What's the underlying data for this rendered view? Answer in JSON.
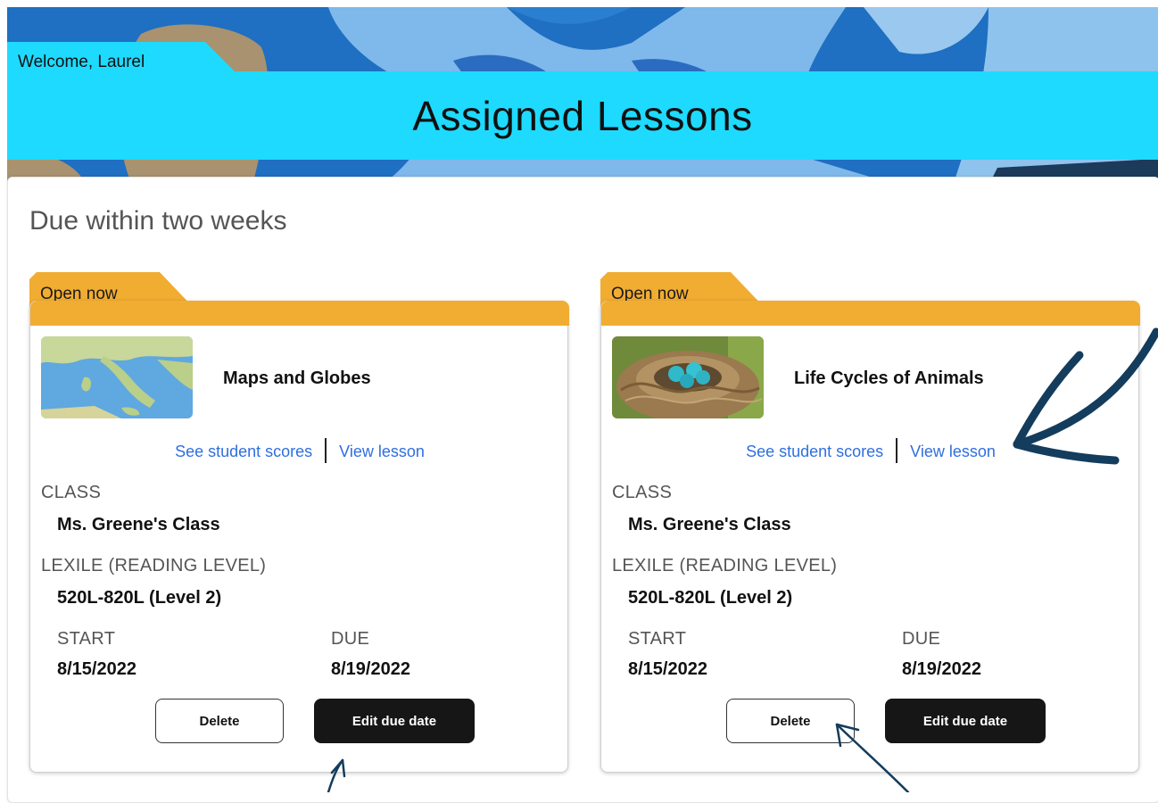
{
  "header": {
    "welcome": "Welcome, Laurel",
    "title": "Assigned Lessons"
  },
  "section_title": "Due within two weeks",
  "cards": [
    {
      "status": "Open now",
      "thumbnail": "map-of-italy-image",
      "lesson_title": "Maps and Globes",
      "links": {
        "scores": "See student scores",
        "view": "View lesson"
      },
      "class_label": "CLASS",
      "class_value": "Ms. Greene's Class",
      "lexile_label": "LEXILE (READING LEVEL)",
      "lexile_value": "520L-820L (Level 2)",
      "start_label": "START",
      "start_value": "8/15/2022",
      "due_label": "DUE",
      "due_value": "8/19/2022",
      "delete_label": "Delete",
      "edit_label": "Edit due date"
    },
    {
      "status": "Open now",
      "thumbnail": "bird-nest-eggs-image",
      "lesson_title": "Life Cycles of Animals",
      "links": {
        "scores": "See student scores",
        "view": "View lesson"
      },
      "class_label": "CLASS",
      "class_value": "Ms. Greene's Class",
      "lexile_label": "LEXILE (READING LEVEL)",
      "lexile_value": "520L-820L (Level 2)",
      "start_label": "START",
      "start_value": "8/15/2022",
      "due_label": "DUE",
      "due_value": "8/19/2022",
      "delete_label": "Delete",
      "edit_label": "Edit due date"
    }
  ],
  "colors": {
    "banner_cyan": "#1edaff",
    "status_tab": "#f1ac32",
    "link_blue": "#2f6fe0",
    "annotation_arrow": "#143c5c"
  }
}
